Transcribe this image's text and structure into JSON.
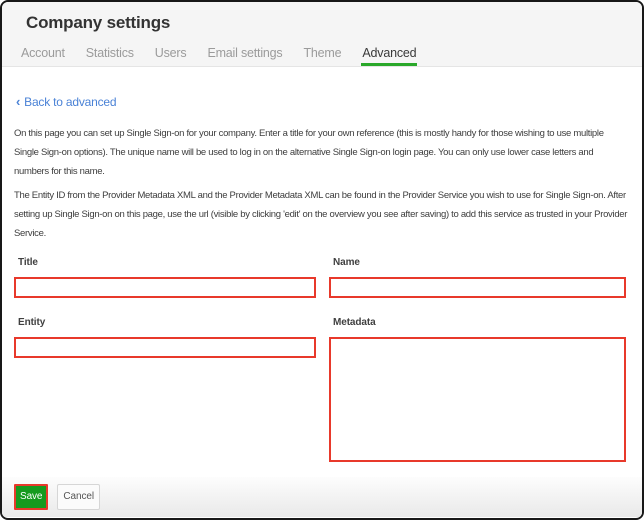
{
  "window": {
    "title": "Company settings"
  },
  "tabs": [
    {
      "label": "Account",
      "active": false
    },
    {
      "label": "Statistics",
      "active": false
    },
    {
      "label": "Users",
      "active": false
    },
    {
      "label": "Email settings",
      "active": false
    },
    {
      "label": "Theme",
      "active": false
    },
    {
      "label": "Advanced",
      "active": true
    }
  ],
  "back_link": {
    "icon": "chevron-left",
    "chevron": "‹",
    "label": "Back to advanced"
  },
  "intro": {
    "p1": "On this page you can set up Single Sign-on for your company. Enter a title for your own reference (this is mostly handy for those wishing to use multiple Single Sign-on options). The unique name will be used to log in on the alternative Single Sign-on login page. You can only use lower case letters and numbers for this name.",
    "p2": "The Entity ID from the Provider Metadata XML and the Provider Metadata XML can be found in the Provider Service you wish to use for Single Sign-on. After setting up Single Sign-on on this page, use the url (visible by clicking 'edit' on the overview you see after saving) to add this service as trusted in your Provider Service."
  },
  "form": {
    "fields": [
      {
        "label": "Title",
        "type": "input",
        "value": ""
      },
      {
        "label": "Name",
        "type": "input",
        "value": ""
      },
      {
        "label": "Entity",
        "type": "input",
        "value": ""
      },
      {
        "label": "Metadata",
        "type": "textarea",
        "value": ""
      }
    ]
  },
  "actions": {
    "save_label": "Save",
    "cancel_label": "Cancel"
  },
  "colors": {
    "error_red": "#e8392b",
    "save_green": "#169a1e",
    "tab_underline_green": "#2aa82a",
    "link_blue": "#4a82d6",
    "header_bg": "#f5f5f5"
  }
}
